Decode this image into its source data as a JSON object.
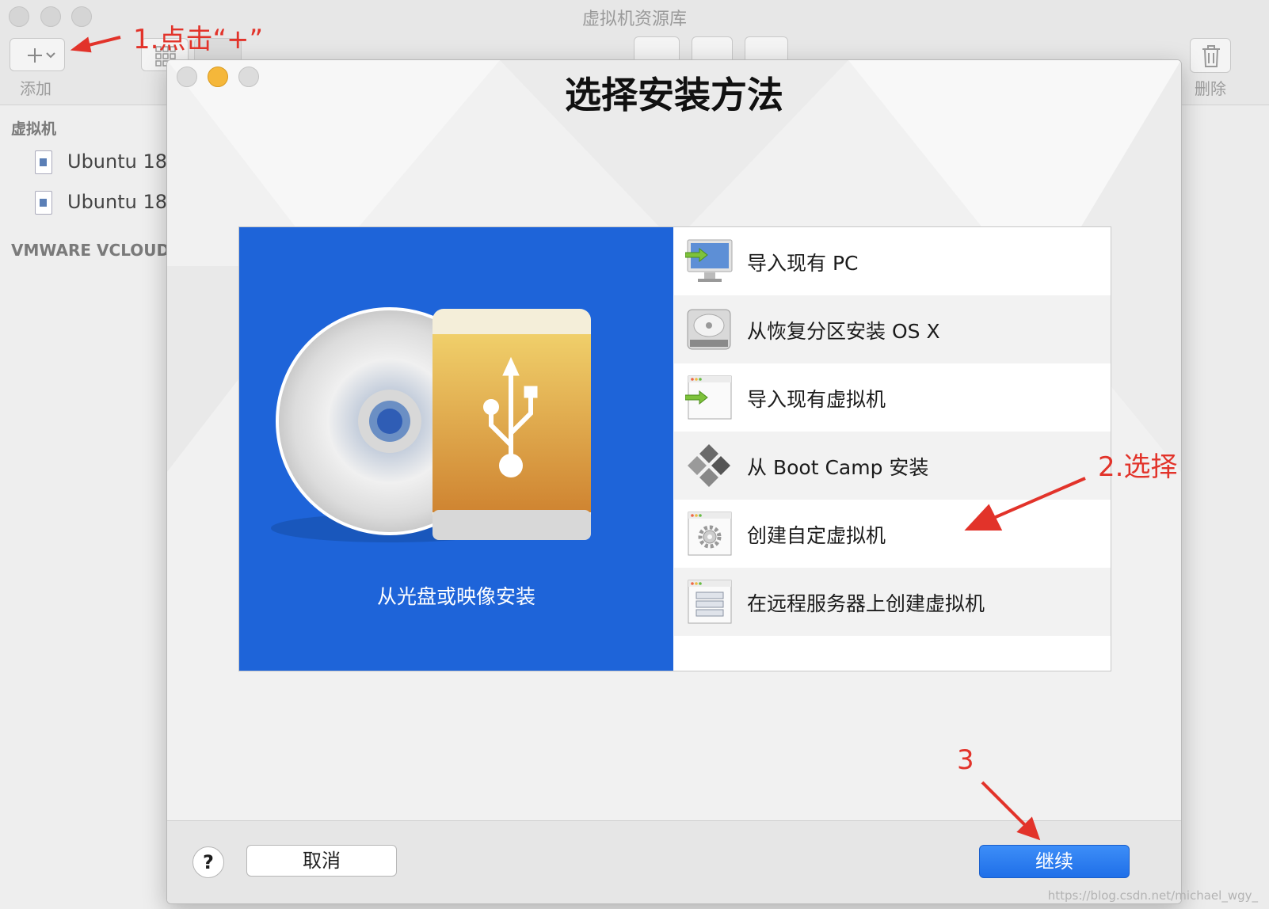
{
  "library_window": {
    "title": "虚拟机资源库",
    "toolbar": {
      "add_label": "添加",
      "delete_label": "删除"
    },
    "sidebar": {
      "section_vm": "虚拟机",
      "items": [
        {
          "label": "Ubuntu 18"
        },
        {
          "label": "Ubuntu 18"
        }
      ],
      "section_cloud": "VMWARE VCLOUD"
    }
  },
  "dialog": {
    "title": "选择安装方法",
    "featured_option": {
      "label": "从光盘或映像安装",
      "icon": "disc-usb-icon"
    },
    "options": [
      {
        "label": "导入现有 PC",
        "icon": "monitor-import-icon"
      },
      {
        "label": "从恢复分区安装 OS X",
        "icon": "hard-drive-icon"
      },
      {
        "label": "导入现有虚拟机",
        "icon": "vm-import-icon"
      },
      {
        "label": "从 Boot Camp 安装",
        "icon": "bootcamp-icon"
      },
      {
        "label": "创建自定虚拟机",
        "icon": "gear-window-icon"
      },
      {
        "label": "在远程服务器上创建虚拟机",
        "icon": "server-window-icon"
      }
    ],
    "help_label": "?",
    "cancel_label": "取消",
    "continue_label": "继续"
  },
  "annotations": {
    "step1": "1.点击“+”",
    "step2": "2.选择",
    "step3": "3"
  },
  "watermark": "https://blog.csdn.net/michael_wgy_",
  "colors": {
    "featured_bg": "#1e64d9",
    "continue_btn": "#2a7af2",
    "annotation": "#e2332a"
  }
}
